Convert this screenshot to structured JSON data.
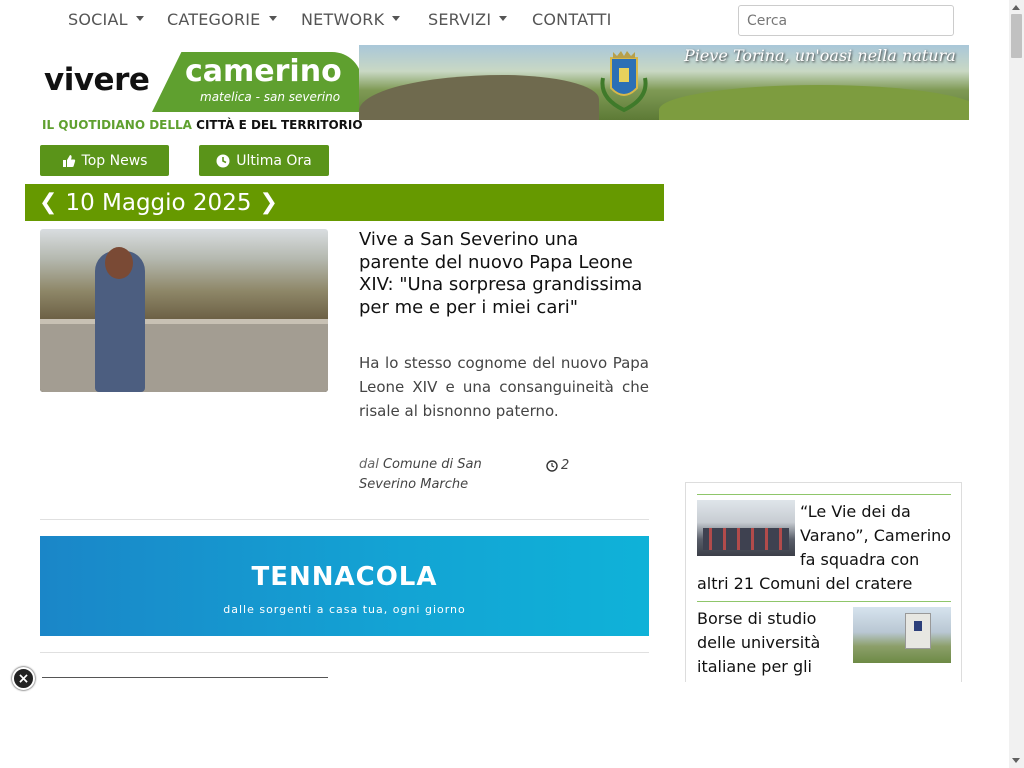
{
  "nav": {
    "items": [
      {
        "label": "SOCIAL",
        "dropdown": true
      },
      {
        "label": "CATEGORIE",
        "dropdown": true
      },
      {
        "label": "NETWORK",
        "dropdown": true
      },
      {
        "label": "SERVIZI",
        "dropdown": true
      },
      {
        "label": "CONTATTI",
        "dropdown": false
      }
    ],
    "search_placeholder": "Cerca"
  },
  "logo": {
    "word1": "vivere",
    "word2": "camerino",
    "sub": "matelica - san severino",
    "tag_green": "IL QUOTIDIANO DELLA",
    "tag_dark": " CITTÀ E DEL TERRITORIO",
    "accent_color": "#5fa02f"
  },
  "banner": {
    "text": "Pieve Torina, un'oasi nella natura"
  },
  "buttons": {
    "top_news": "Top News",
    "ultima_ora": "Ultima Ora",
    "color": "#5a9419"
  },
  "datebar": {
    "date": "10 Maggio 2025",
    "color": "#669900"
  },
  "article": {
    "title": "Vive a San Severino una parente del nuovo Papa Leone XIV: \"Una sorpresa grandissima per me e per i miei cari\"",
    "summary": "Ha lo stesso cognome del nuovo Papa Leone XIV e una consanguineità che risale al bisnonno paterno.",
    "by_prefix": "dal",
    "author": "Comune di San Severino Marche",
    "comments": "2"
  },
  "ad": {
    "brand": "TENNACOLA",
    "tagline": "dalle sorgenti a casa tua, ogni giorno"
  },
  "sidebar": {
    "items": [
      {
        "title": "“Le Vie dei da Varano”, Camerino fa squadra con altri 21 Comuni del cratere"
      },
      {
        "title": "Borse di studio delle università italiane per gli"
      }
    ]
  },
  "close_icon": "×"
}
